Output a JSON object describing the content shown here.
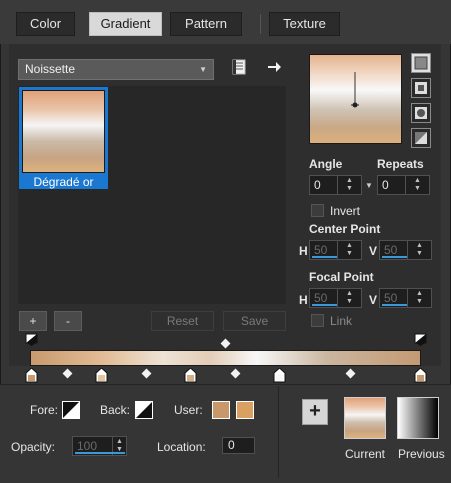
{
  "tabs": [
    {
      "label": "Color",
      "active": false
    },
    {
      "label": "Gradient",
      "active": true
    },
    {
      "label": "Pattern",
      "active": false
    },
    {
      "label": "Texture",
      "active": false
    }
  ],
  "library": {
    "dropdown_value": "Noissette",
    "selected_gradient_name": "Dégradé or"
  },
  "buttons": {
    "add": "+",
    "remove": "-",
    "reset": "Reset",
    "save": "Save"
  },
  "settings": {
    "angle_label": "Angle",
    "angle_value": "0",
    "repeats_label": "Repeats",
    "repeats_value": "0",
    "invert_label": "Invert",
    "center_point_label": "Center Point",
    "center_h_label": "H",
    "center_h_value": "50",
    "center_v_label": "V",
    "center_v_value": "50",
    "focal_point_label": "Focal Point",
    "focal_h_label": "H",
    "focal_h_value": "50",
    "focal_v_label": "V",
    "focal_v_value": "50",
    "link_label": "Link"
  },
  "bottom": {
    "fore_label": "Fore:",
    "back_label": "Back:",
    "user_label": "User:",
    "opacity_label": "Opacity:",
    "opacity_value": "100",
    "location_label": "Location:",
    "location_value": "0",
    "current_label": "Current",
    "previous_label": "Previous"
  },
  "colors": {
    "user_color_1": "#c8976a",
    "user_color_2": "#d9a062",
    "accent": "#1a78d0"
  }
}
